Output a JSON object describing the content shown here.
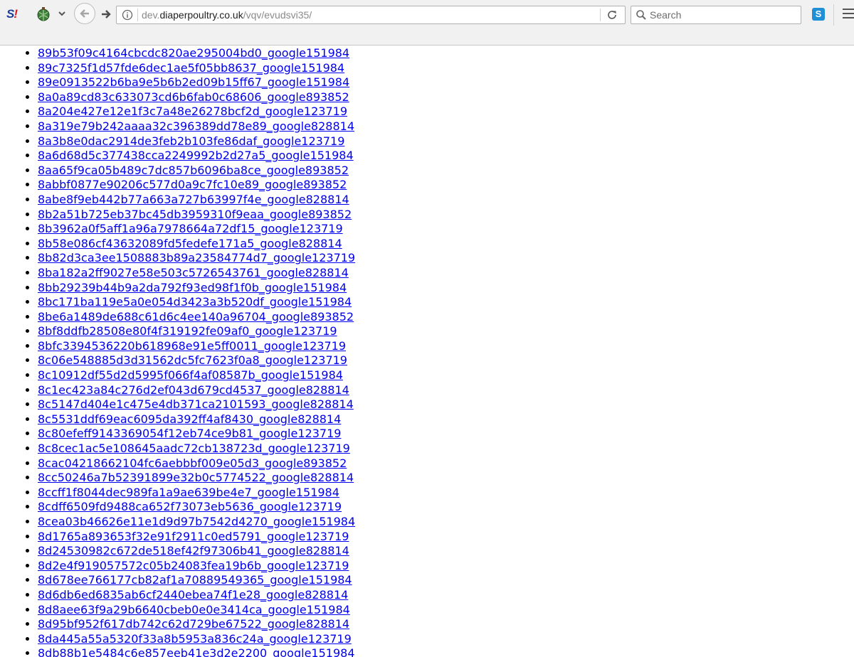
{
  "browser": {
    "url_scheme_and_sub": "dev.",
    "url_domain": "diaperpoultry.co.uk",
    "url_path": "/vqv/evudsvi35/",
    "search_placeholder": "Search",
    "ext_s_letter": "S",
    "ext_s_mark": "!",
    "skype_letter": "S"
  },
  "links": [
    "89b53f09c4164cbcdc820ae295004bd0_google151984",
    "89c7325f1d57fde6dec1ae5f05bb8637_google151984",
    "89e0913522b6ba9e5b6b2ed09b15ff67_google151984",
    "8a0a89cd83c633073cd6b6fab0c68606_google893852",
    "8a204e427e12e1f3c7a48e26278bcf2d_google123719",
    "8a319e79b242aaaa32c396389dd78e89_google828814",
    "8a3b8e0dac2914de3feb2b103fe86daf_google123719",
    "8a6d68d5c377438cca2249992b2d27a5_google151984",
    "8aa65f9ca05b489c7dc857b6096ba8ce_google893852",
    "8abbf0877e90206c577d0a9c7fc10e89_google893852",
    "8abe8f9eb442b77a663a727b63997f4e_google828814",
    "8b2a51b725eb37bc45db3959310f9eaa_google893852",
    "8b3962a0f5aff1a96a7978664a72df15_google123719",
    "8b58e086cf43632089fd5fedefe171a5_google828814",
    "8b82d3ca3ee1508883b89a23584774d7_google123719",
    "8ba182a2ff9027e58e503c5726543761_google828814",
    "8bb29239b44b9a2da792f93ed98f1f0b_google151984",
    "8bc171ba119e5a0e054d3423a3b520df_google151984",
    "8be6a1489de688c61d6c4ee140a96704_google893852",
    "8bf8ddfb28508e80f4f319192fe09af0_google123719",
    "8bfc3394536220b618968e91e5ff0011_google123719",
    "8c06e548885d3d31562dc5fc7623f0a8_google123719",
    "8c10912df55d2d5995f066f4af08587b_google151984",
    "8c1ec423a84c276d2ef043d679cd4537_google828814",
    "8c5147d404e1c475e4db371ca2101593_google828814",
    "8c5531ddf69eac6095da392ff4af8430_google828814",
    "8c80efeff9143369054f12eb74ce9b81_google123719",
    "8c8cec1ac5e108645aadc72cb138723d_google123719",
    "8cac04218662104fc6aebbbf009e05d3_google893852",
    "8cc50246a7b52391899e32b0c5774522_google828814",
    "8ccff1f8044dec989fa1a9ae639be4e7_google151984",
    "8cdff6509fd9488ca652f73073eb5636_google123719",
    "8cea03b46626e11e1d9d97b7542d4270_google151984",
    "8d1765a893653f32e91f2911c0ed5791_google123719",
    "8d24530982c672de518ef42f97306b41_google828814",
    "8d2e4f919057572c05b24083fea19b6b_google123719",
    "8d678ee766177cb82af1a70889549365_google151984",
    "8d6db6ed6835ab6cf2440ebea74f1e28_google828814",
    "8d8aee63f9a29b6640cbeb0e0e3414ca_google151984",
    "8d95bf952f617db742c62d729be67522_google828814",
    "8da445a55a5320f33a8b5953a836c24a_google123719",
    "8db88b1e5484c6e857eeb41e3d2e2200_google151984"
  ]
}
